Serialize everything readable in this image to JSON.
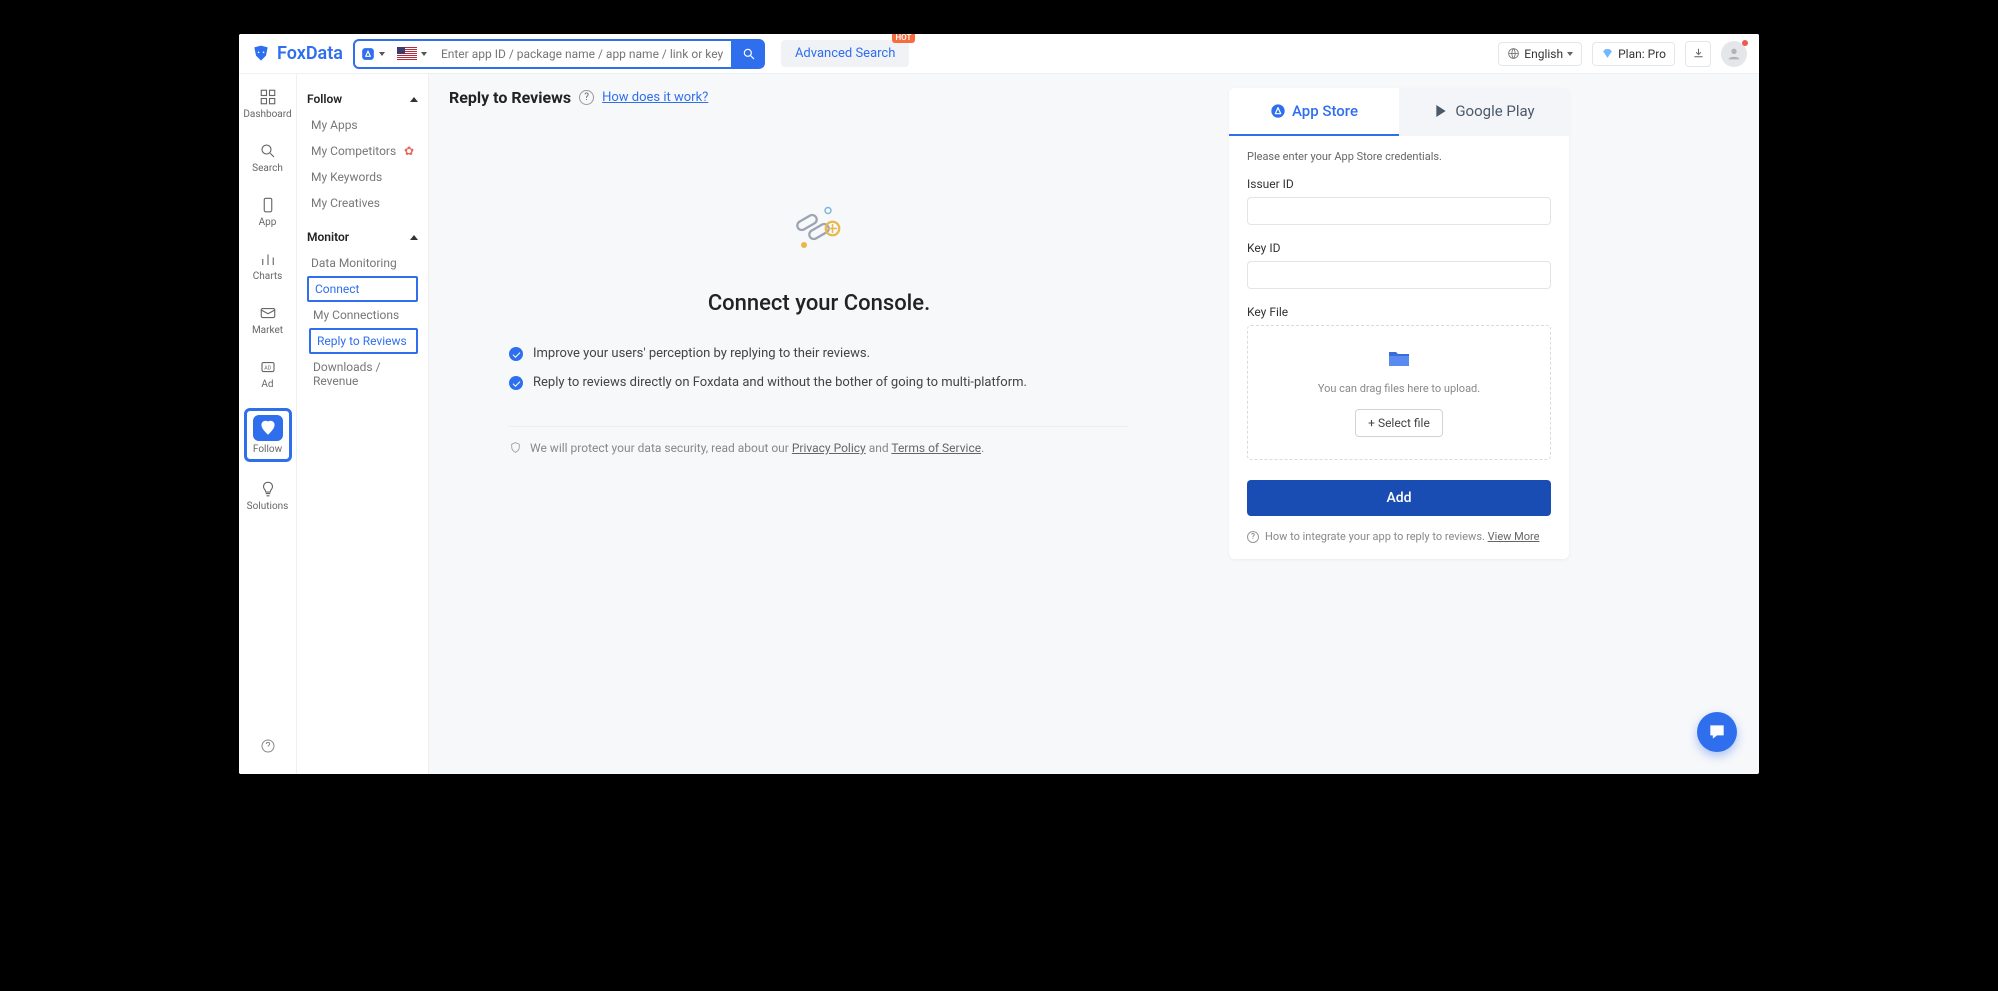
{
  "brand": "FoxData",
  "search_placeholder": "Enter app ID / package name / app name / link or keyword...",
  "advanced_search": "Advanced Search",
  "hot_badge": "HOT",
  "language": "English",
  "plan_label": "Plan: Pro",
  "rail": {
    "dashboard": "Dashboard",
    "search": "Search",
    "app": "App",
    "charts": "Charts",
    "market": "Market",
    "ad": "Ad",
    "follow": "Follow",
    "solutions": "Solutions"
  },
  "sidebar": {
    "follow_head": "Follow",
    "my_apps": "My Apps",
    "my_competitors": "My Competitors",
    "my_keywords": "My Keywords",
    "my_creatives": "My Creatives",
    "monitor_head": "Monitor",
    "data_monitoring": "Data Monitoring",
    "connect": "Connect",
    "my_connections": "My Connections",
    "reply_to_reviews": "Reply to Reviews",
    "downloads_revenue": "Downloads / Revenue"
  },
  "page": {
    "title": "Reply to Reviews",
    "how_link": "How does it work?",
    "hero_title": "Connect your Console.",
    "feat1": "Improve your users' perception by replying to their reviews.",
    "feat2": "Reply to reviews directly on Foxdata and without the bother of going to multi-platform.",
    "protect_pre": "We will protect your data security, read about our ",
    "privacy": "Privacy Policy",
    "and": " and ",
    "terms": "Terms of Service"
  },
  "panel": {
    "tab_appstore": "App Store",
    "tab_google": "Google Play",
    "hint": "Please enter your App Store credentials.",
    "issuer_label": "Issuer ID",
    "keyid_label": "Key ID",
    "keyfile_label": "Key File",
    "drop_text": "You can drag files here to upload.",
    "select_file": "+ Select file",
    "add_btn": "Add",
    "foot_text": "How to integrate your app to reply to reviews.",
    "view_more": "View More"
  }
}
